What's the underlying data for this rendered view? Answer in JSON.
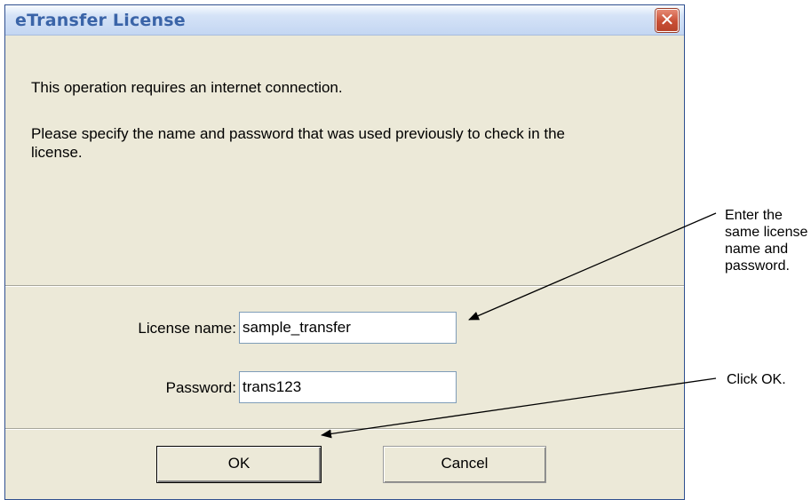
{
  "dialog": {
    "title": "eTransfer License",
    "close_glyph": "✕",
    "message_1": "This operation requires an internet connection.",
    "message_2": "Please specify the name and password that was used previously to check in the license.",
    "license_name_label": "License name:",
    "license_name_value": "sample_transfer",
    "password_label": "Password:",
    "password_value": "trans123",
    "ok_label": "OK",
    "cancel_label": "Cancel"
  },
  "annotations": {
    "enter_note": "Enter the same license name and password.",
    "click_note": "Click OK."
  },
  "icons": {
    "close": "close-icon"
  },
  "colors": {
    "dialog_bg": "#ece9d8",
    "title_text": "#3a64a8",
    "close_button": "#c94f35"
  }
}
